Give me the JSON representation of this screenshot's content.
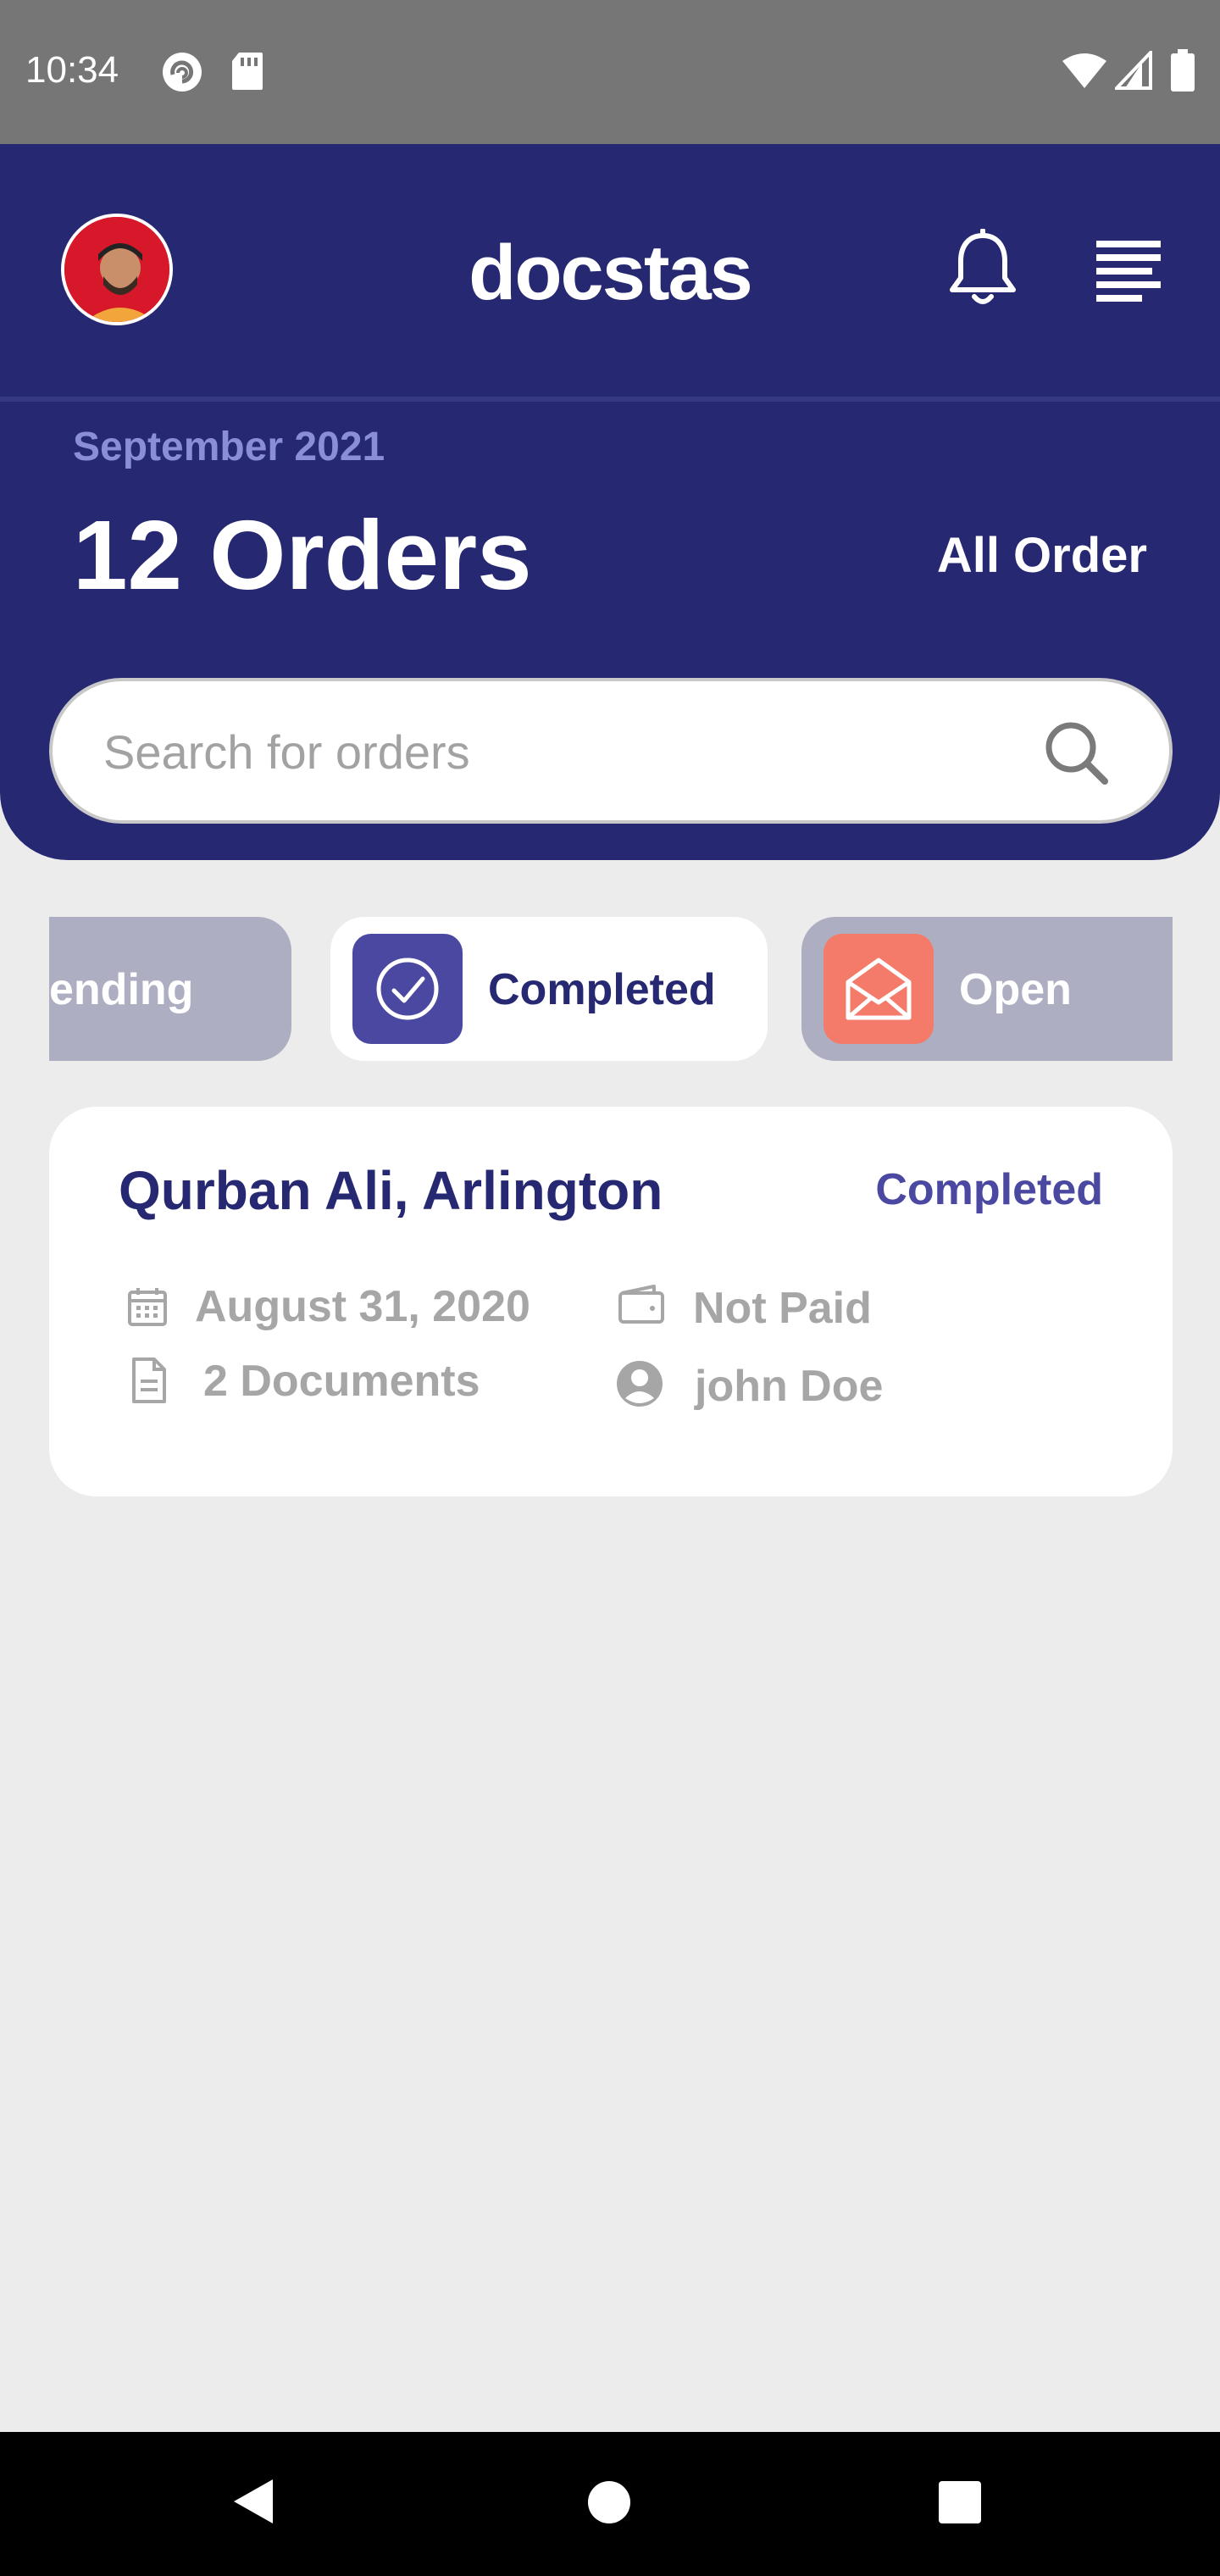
{
  "status_bar": {
    "time": "10:34"
  },
  "header": {
    "app_name": "docstas",
    "month": "September 2021",
    "orders_count": "12 Orders",
    "all_order_label": "All Order"
  },
  "search": {
    "placeholder": "Search for orders",
    "value": ""
  },
  "tabs": [
    {
      "label": "Pending",
      "visible_text": "ending",
      "icon": "pending-icon"
    },
    {
      "label": "Completed",
      "icon": "check-circle-icon",
      "selected": true
    },
    {
      "label": "Open",
      "icon": "open-envelope-icon"
    }
  ],
  "orders": [
    {
      "title": "Qurban Ali, Arlington",
      "status": "Completed",
      "date": "August 31, 2020",
      "documents": "2 Documents",
      "payment": "Not Paid",
      "user": "john Doe"
    }
  ],
  "colors": {
    "primary": "#262872",
    "accent": "#4a48a0",
    "open_accent": "#f47a6a",
    "inactive_tab": "#aeaec2",
    "background": "#ececec"
  }
}
